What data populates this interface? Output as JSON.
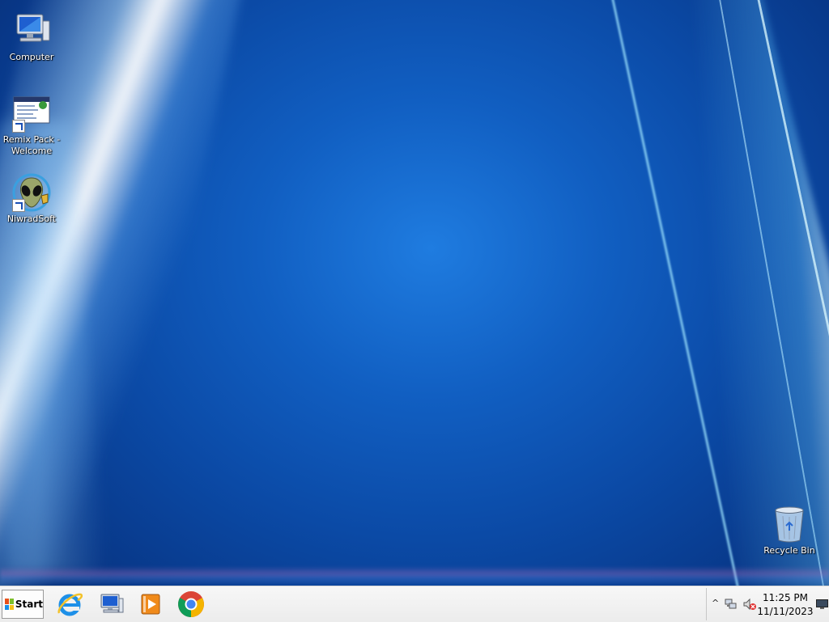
{
  "desktop": {
    "icons": [
      {
        "label": "Computer"
      },
      {
        "label": "Remix Pack - Welcome"
      },
      {
        "label": "NiwradSoft"
      },
      {
        "label": "Recycle Bin"
      }
    ]
  },
  "taskbar": {
    "start_label": "Start",
    "pinned": [
      {
        "icon": "internet-explorer-icon"
      },
      {
        "icon": "computer-icon"
      },
      {
        "icon": "media-player-icon"
      },
      {
        "icon": "chrome-icon"
      }
    ],
    "tray": {
      "time": "11:25 PM",
      "date": "11/11/2023"
    }
  },
  "colors": {
    "desktop_blue": "#0b4aa6",
    "taskbar_bg": "#f0f0f0"
  }
}
